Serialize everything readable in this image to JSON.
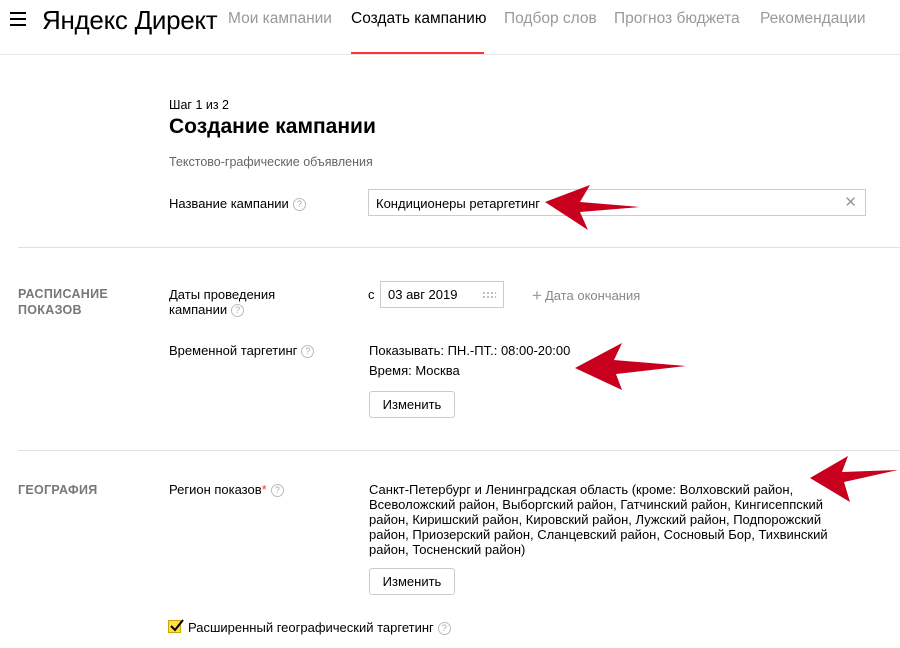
{
  "header": {
    "logo_prefix": "Яндекс",
    "logo_name": "Директ",
    "nav": [
      "Мои кампании",
      "Создать кампанию",
      "Подбор слов",
      "Прогноз бюджета",
      "Рекомендации"
    ],
    "active_tab": "Создать кампанию"
  },
  "form": {
    "step": "Шаг 1 из 2",
    "title": "Создание кампании",
    "subtitle": "Текстово-графические объявления",
    "name_label": "Название кампании",
    "name_value": "Кондиционеры ретаргетинг"
  },
  "schedule": {
    "section_title_1": "РАСПИСАНИЕ",
    "section_title_2": "ПОКАЗОВ",
    "dates_label_1": "Даты проведения",
    "dates_label_2": "кампании",
    "date_prefix": "с",
    "start_date": "03 авг 2019",
    "end_date_link": "Дата окончания",
    "time_label": "Временной таргетинг",
    "time_show": "Показывать: ПН.-ПТ.: 08:00-20:00",
    "time_zone": "Время: Москва",
    "change_button": "Изменить"
  },
  "geo": {
    "section_title": "ГЕОГРАФИЯ",
    "region_label": "Регион показов",
    "required_mark": "*",
    "region_value": "Санкт-Петербург и Ленинградская область (кроме: Волховский район, Всеволожский район, Выборгский район, Гатчинский район, Кингисеппский район, Киришский район, Кировский район, Лужский район, Подпорожский район, Приозерский район, Сланцевский район, Сосновый Бор, Тихвинский район, Тосненский район)",
    "change_button": "Изменить",
    "extended_label": "Расширенный географический таргетинг",
    "extended_checked": true
  },
  "colors": {
    "accent_red": "#ff3333",
    "arrow_red": "#c8001e",
    "checkbox_yellow": "#ffdb4d"
  }
}
